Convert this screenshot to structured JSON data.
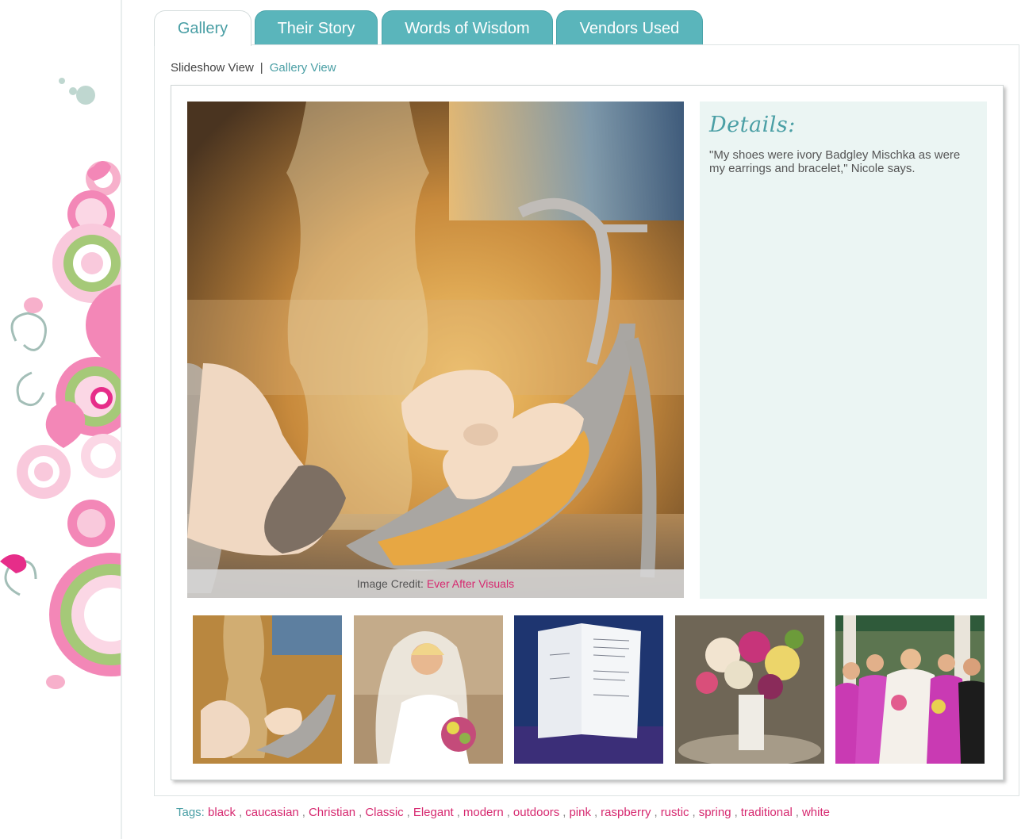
{
  "tabs": [
    {
      "label": "Gallery",
      "active": true
    },
    {
      "label": "Their Story",
      "active": false
    },
    {
      "label": "Words of Wisdom",
      "active": false
    },
    {
      "label": "Vendors Used",
      "active": false
    }
  ],
  "view_links": {
    "slideshow": "Slideshow View",
    "separator": "|",
    "gallery": "Gallery View"
  },
  "photo": {
    "credit_prefix": "Image Credit:",
    "credit_link": "Ever After Visuals"
  },
  "details": {
    "title": "Details:",
    "text": "\"My shoes were ivory Badgley Mischka as were my earrings and bracelet,\" Nicole says."
  },
  "tags": {
    "label": "Tags:",
    "items": [
      "black",
      "caucasian",
      "Christian",
      "Classic",
      "Elegant",
      "modern",
      "outdoors",
      "pink",
      "raspberry",
      "rustic",
      "spring",
      "traditional",
      "white"
    ]
  },
  "colors": {
    "accent": "#5ab5bb",
    "link": "#4a9fa5",
    "tag": "#d6286f",
    "details_bg": "#ebf5f3"
  },
  "thumbnails": [
    "shoes-thumbnail",
    "bride-thumbnail",
    "program-thumbnail",
    "bouquet-thumbnail",
    "bridesmaids-thumbnail"
  ]
}
